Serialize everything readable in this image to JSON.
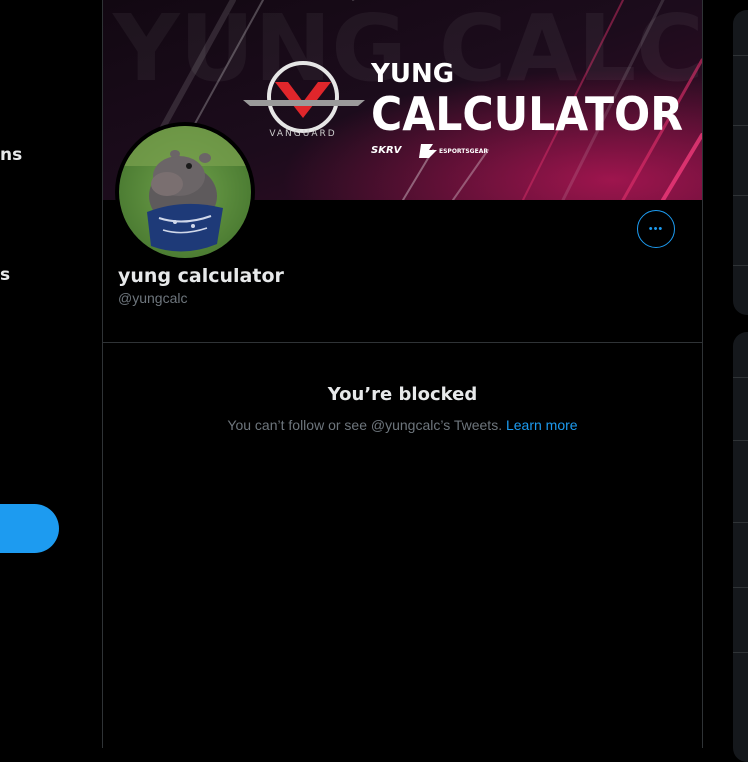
{
  "left_nav": {
    "item_fragment_1": "ns",
    "item_fragment_2": "s"
  },
  "banner": {
    "brand_small": "VANGUARD",
    "title_line1": "YUNG",
    "title_line2": "CALCULATOR",
    "sponsor_1": "SKRV",
    "sponsor_2": "ESPORTSGEAR",
    "background_word": "YUNG CALCULATOR",
    "accent_color": "#e3306c",
    "logo_color": "#e0262b"
  },
  "profile": {
    "display_name": "yung calculator",
    "handle": "@yungcalc",
    "more_label": "•••"
  },
  "blocked": {
    "title": "You’re blocked",
    "message": "You can’t follow or see @yungcalc’s Tweets. ",
    "link": "Learn more"
  },
  "colors": {
    "background": "#000000",
    "accent": "#1d9bf0",
    "border": "#2f3336",
    "muted_text": "#6e767d"
  }
}
